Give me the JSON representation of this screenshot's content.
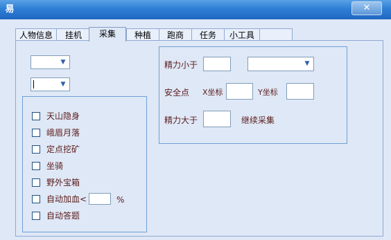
{
  "window": {
    "app_icon": "game-assistant-icon",
    "app_icon_glyph": "易",
    "close_glyph": "✕"
  },
  "tabs": [
    {
      "label": "人物信息"
    },
    {
      "label": "挂机"
    },
    {
      "label": "采集"
    },
    {
      "label": "种植"
    },
    {
      "label": "跑商"
    },
    {
      "label": "任务"
    },
    {
      "label": "小工具"
    },
    {
      "label": ""
    }
  ],
  "active_tab": "采集",
  "collect": {
    "dropdown1": {
      "value": ""
    },
    "dropdown2": {
      "value": ""
    },
    "options": [
      {
        "label": "天山隐身",
        "checked": false
      },
      {
        "label": "峨眉月落",
        "checked": false
      },
      {
        "label": "定点挖矿",
        "checked": false
      },
      {
        "label": "坐骑",
        "checked": false
      },
      {
        "label": "野外宝箱",
        "checked": false
      },
      {
        "label": "自动加血<",
        "checked": false
      },
      {
        "label": "自动答题",
        "checked": false
      }
    ],
    "auto_heal_value": "",
    "auto_heal_unit": "%"
  },
  "energy": {
    "less_than_label": "精力小于",
    "less_than_value": "",
    "less_than_dropdown": "",
    "safe_point_label": "安全点",
    "x_label": "X坐标",
    "x_value": "",
    "y_label": "Y坐标",
    "y_value": "",
    "greater_than_label": "精力大于",
    "greater_than_value": "",
    "continue_label": "继续采集"
  },
  "colors": {
    "titlebar": "#2f7fd6",
    "panel": "#dfe8f6",
    "label_text": "#5a1c1c",
    "group_border": "#6fa0d6"
  }
}
